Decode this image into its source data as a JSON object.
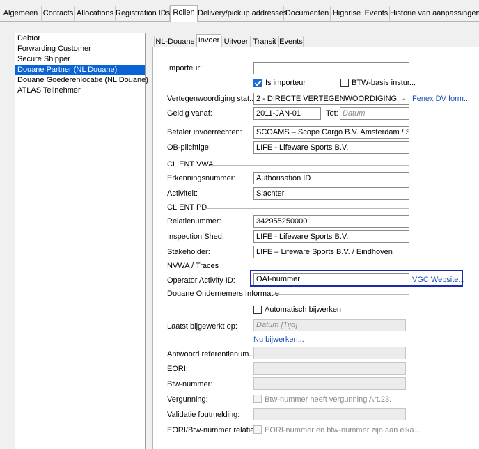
{
  "top_tabs": [
    {
      "label": "Algemeen",
      "active": false
    },
    {
      "label": "Contacts",
      "active": false
    },
    {
      "label": "Allocations",
      "active": false
    },
    {
      "label": "Registration IDs",
      "active": false
    },
    {
      "label": "Rollen",
      "active": true
    },
    {
      "label": "Delivery/pickup addresses",
      "active": false
    },
    {
      "label": "Documenten",
      "active": false
    },
    {
      "label": "Highrise",
      "active": false
    },
    {
      "label": "Events",
      "active": false
    },
    {
      "label": "Historie van aanpassingen",
      "active": false
    }
  ],
  "roles": {
    "items": [
      {
        "label": "Debtor",
        "selected": false
      },
      {
        "label": "Forwarding Customer",
        "selected": false
      },
      {
        "label": "Secure Shipper",
        "selected": false
      },
      {
        "label": "Douane Partner (NL Douane)",
        "selected": true
      },
      {
        "label": "Douane Goederenlocatie (NL Douane)",
        "selected": false
      },
      {
        "label": "ATLAS Teilnehmer",
        "selected": false
      }
    ]
  },
  "sub_tabs": [
    {
      "label": "NL-Douane",
      "active": false
    },
    {
      "label": "Invoer",
      "active": true
    },
    {
      "label": "Uitvoer",
      "active": false
    },
    {
      "label": "Transit",
      "active": false
    },
    {
      "label": "Events",
      "active": false
    }
  ],
  "form": {
    "importeur": {
      "label": "Importeur:",
      "value": ""
    },
    "is_importeur": {
      "label": "Is importeur",
      "checked": true
    },
    "btw_basis": {
      "label": "BTW-basis instur...",
      "checked": false
    },
    "vertegenwoordiging": {
      "label": "Vertegenwoordiging stat...",
      "value": "2 - DIRECTE VERTEGENWOORDIGING",
      "link": "Fenex DV form..."
    },
    "geldig_vanaf": {
      "label": "Geldig vanaf:",
      "value": "2011-JAN-01",
      "tot_label": "Tot:",
      "tot_placeholder": "Datum"
    },
    "betaler": {
      "label": "Betaler invoerrechten:",
      "value": "SCOAMS – Scope Cargo B.V. Amsterdam / Schiphol"
    },
    "ob_plichtige": {
      "label": "OB-plichtige:",
      "value": "LIFE - Lifeware Sports B.V."
    },
    "client_vwa": {
      "title": "CLIENT VWA",
      "erkenningsnummer": {
        "label": "Erkenningsnummer:",
        "value": "Authorisation ID"
      },
      "activiteit": {
        "label": "Activiteit:",
        "value": "Slachter"
      }
    },
    "client_pd": {
      "title": "CLIENT PD",
      "relatienummer": {
        "label": "Relatienummer:",
        "value": "342955250000"
      },
      "inspection_shed": {
        "label": "Inspection Shed:",
        "value": "LIFE - Lifeware Sports B.V."
      },
      "stakeholder": {
        "label": "Stakeholder:",
        "value": "LIFE – Lifeware Sports B.V. / Eindhoven"
      }
    },
    "nvwa": {
      "title": "NVWA / Traces",
      "operator_activity": {
        "label": "Operator Activity ID:",
        "value": "OAI-nummer",
        "link": "VGC Website..."
      }
    },
    "douane_ondernemers": {
      "title": "Douane Ondernemers Informatie",
      "automatisch": {
        "label": "Automatisch bijwerken",
        "checked": false
      },
      "laatst_bijgewerkt": {
        "label": "Laatst bijgewerkt op:",
        "placeholder": "Datum [Tijd]"
      },
      "nu_bijwerken": "Nu bijwerken...",
      "antwoord": {
        "label": "Antwoord referentienum...",
        "value": ""
      },
      "eori": {
        "label": "EORI:",
        "value": ""
      },
      "btw_nummer": {
        "label": "Btw-nummer:",
        "value": ""
      },
      "vergunning": {
        "label": "Vergunning:",
        "checkbox_label": "Btw-nummer heeft vergunning Art.23."
      },
      "validatie": {
        "label": "Validatie foutmelding:",
        "value": ""
      },
      "relatie": {
        "label": "EORI/Btw-nummer relatie:",
        "checkbox_label": "EORI-nummer en btw-nummer zijn aan elka..."
      }
    }
  },
  "colors": {
    "selection": "#0a64d6",
    "highlight": "#1a2bb0",
    "link": "#1a4fb5"
  }
}
